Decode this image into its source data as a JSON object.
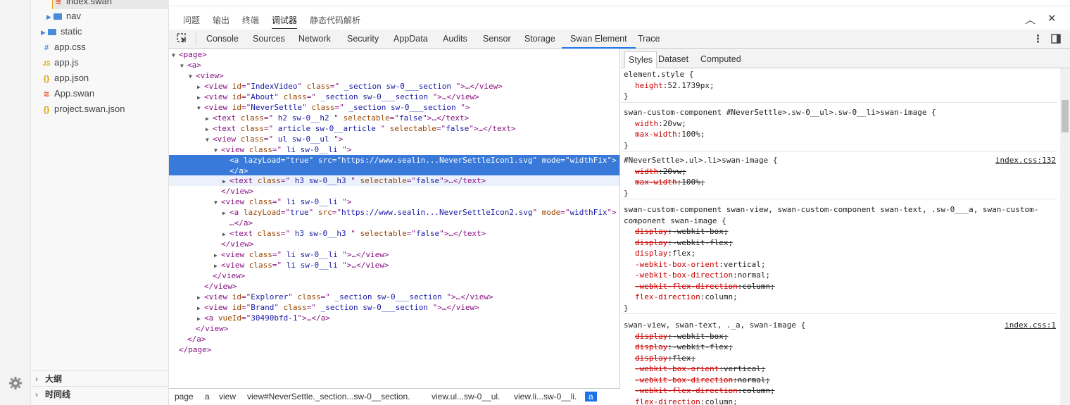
{
  "explorer": {
    "items": [
      {
        "label": "index.swan",
        "icon": "swan-file-icon",
        "type": "file"
      },
      {
        "label": "nav",
        "type": "folder"
      },
      {
        "label": "static",
        "type": "folder"
      },
      {
        "label": "app.css",
        "icon_glyph": "#",
        "type": "file"
      },
      {
        "label": "app.js",
        "icon_glyph": "JS",
        "type": "file"
      },
      {
        "label": "app.json",
        "icon_glyph": "{}",
        "type": "file"
      },
      {
        "label": "App.swan",
        "icon_glyph": "≋",
        "type": "file"
      },
      {
        "label": "project.swan.json",
        "icon_glyph": "{}",
        "type": "file"
      }
    ],
    "outline_label": "大纲",
    "timeline_label": "时间线"
  },
  "panel": {
    "tabs": [
      "问题",
      "输出",
      "终端",
      "调试器",
      "静态代码解析"
    ],
    "active_tab": "调试器"
  },
  "devtools": {
    "tabs": [
      "Console",
      "Sources",
      "Network",
      "Security",
      "AppData",
      "Audits",
      "Sensor",
      "Storage",
      "Swan Element",
      "Trace"
    ],
    "active_tab": "Swan Element"
  },
  "elements": {
    "lines": [
      {
        "tri": "▼",
        "parts": [
          [
            "tag",
            "<page>"
          ]
        ]
      },
      {
        "tri": "▼",
        "parts": [
          [
            "tag",
            "<a>"
          ]
        ]
      },
      {
        "tri": "▼",
        "parts": [
          [
            "tag",
            "<view>"
          ]
        ]
      },
      {
        "tri": "▶",
        "parts": [
          [
            "tag",
            "<view "
          ],
          [
            "an",
            "id"
          ],
          [
            "tag",
            "=\""
          ],
          [
            "av",
            "IndexVideo"
          ],
          [
            "tag",
            "\" "
          ],
          [
            "an",
            "class"
          ],
          [
            "tag",
            "=\""
          ],
          [
            "av",
            " _section sw-0___section "
          ],
          [
            "tag",
            "\">…</view>"
          ]
        ]
      },
      {
        "tri": "▶",
        "parts": [
          [
            "tag",
            "<view "
          ],
          [
            "an",
            "id"
          ],
          [
            "tag",
            "=\""
          ],
          [
            "av",
            "About"
          ],
          [
            "tag",
            "\" "
          ],
          [
            "an",
            "class"
          ],
          [
            "tag",
            "=\""
          ],
          [
            "av",
            " _section sw-0___section "
          ],
          [
            "tag",
            "\">…</view>"
          ]
        ]
      },
      {
        "tri": "▼",
        "parts": [
          [
            "tag",
            "<view "
          ],
          [
            "an",
            "id"
          ],
          [
            "tag",
            "=\""
          ],
          [
            "av",
            "NeverSettle"
          ],
          [
            "tag",
            "\" "
          ],
          [
            "an",
            "class"
          ],
          [
            "tag",
            "=\""
          ],
          [
            "av",
            " _section sw-0___section "
          ],
          [
            "tag",
            "\">"
          ]
        ]
      },
      {
        "tri": "▶",
        "parts": [
          [
            "tag",
            "<text "
          ],
          [
            "an",
            "class"
          ],
          [
            "tag",
            "=\""
          ],
          [
            "av",
            " h2 sw-0__h2 "
          ],
          [
            "tag",
            "\" "
          ],
          [
            "an",
            "selectable"
          ],
          [
            "tag",
            "=\""
          ],
          [
            "av",
            "false"
          ],
          [
            "tag",
            "\">…</text>"
          ]
        ]
      },
      {
        "tri": "▶",
        "parts": [
          [
            "tag",
            "<text "
          ],
          [
            "an",
            "class"
          ],
          [
            "tag",
            "=\""
          ],
          [
            "av",
            " article sw-0__article "
          ],
          [
            "tag",
            "\" "
          ],
          [
            "an",
            "selectable"
          ],
          [
            "tag",
            "=\""
          ],
          [
            "av",
            "false"
          ],
          [
            "tag",
            "\">…</text>"
          ]
        ]
      },
      {
        "tri": "▼",
        "parts": [
          [
            "tag",
            "<view "
          ],
          [
            "an",
            "class"
          ],
          [
            "tag",
            "=\""
          ],
          [
            "av",
            " ul sw-0__ul "
          ],
          [
            "tag",
            "\">"
          ]
        ]
      },
      {
        "tri": "▼",
        "parts": [
          [
            "tag",
            "<view "
          ],
          [
            "an",
            "class"
          ],
          [
            "tag",
            "=\""
          ],
          [
            "av",
            " li sw-0__li "
          ],
          [
            "tag",
            "\">"
          ]
        ]
      },
      {
        "tri": "",
        "parts": [
          [
            "tag",
            "<a "
          ],
          [
            "an",
            "lazyLoad"
          ],
          [
            "tag",
            "=\""
          ],
          [
            "av",
            "true"
          ],
          [
            "tag",
            "\" "
          ],
          [
            "an",
            "src"
          ],
          [
            "tag",
            "=\""
          ],
          [
            "av",
            "https://www.sealin...NeverSettleIcon1.svg"
          ],
          [
            "tag",
            "\" "
          ],
          [
            "an",
            "mode"
          ],
          [
            "tag",
            "=\""
          ],
          [
            "av",
            "widthFix"
          ],
          [
            "tag",
            "\">"
          ]
        ]
      },
      {
        "tri": "",
        "parts": [
          [
            "tag",
            "</a>"
          ]
        ]
      },
      {
        "tri": "▶",
        "parts": [
          [
            "tag",
            "<text "
          ],
          [
            "an",
            "class"
          ],
          [
            "tag",
            "=\""
          ],
          [
            "av",
            " h3 sw-0__h3 "
          ],
          [
            "tag",
            "\" "
          ],
          [
            "an",
            "selectable"
          ],
          [
            "tag",
            "=\""
          ],
          [
            "av",
            "false"
          ],
          [
            "tag",
            "\">…</text>"
          ]
        ]
      },
      {
        "tri": "",
        "parts": [
          [
            "tag",
            "</view>"
          ]
        ]
      },
      {
        "tri": "▼",
        "parts": [
          [
            "tag",
            "<view "
          ],
          [
            "an",
            "class"
          ],
          [
            "tag",
            "=\""
          ],
          [
            "av",
            " li sw-0__li "
          ],
          [
            "tag",
            "\">"
          ]
        ]
      },
      {
        "tri": "▶",
        "parts": [
          [
            "tag",
            "<a "
          ],
          [
            "an",
            "lazyLoad"
          ],
          [
            "tag",
            "=\""
          ],
          [
            "av",
            "true"
          ],
          [
            "tag",
            "\" "
          ],
          [
            "an",
            "src"
          ],
          [
            "tag",
            "=\""
          ],
          [
            "av",
            "https://www.sealin...NeverSettleIcon2.svg"
          ],
          [
            "tag",
            "\" "
          ],
          [
            "an",
            "mode"
          ],
          [
            "tag",
            "=\""
          ],
          [
            "av",
            "widthFix"
          ],
          [
            "tag",
            "\">"
          ]
        ]
      },
      {
        "tri": "",
        "parts": [
          [
            "tag",
            "…</a>"
          ]
        ]
      },
      {
        "tri": "▶",
        "parts": [
          [
            "tag",
            "<text "
          ],
          [
            "an",
            "class"
          ],
          [
            "tag",
            "=\""
          ],
          [
            "av",
            " h3 sw-0__h3 "
          ],
          [
            "tag",
            "\" "
          ],
          [
            "an",
            "selectable"
          ],
          [
            "tag",
            "=\""
          ],
          [
            "av",
            "false"
          ],
          [
            "tag",
            "\">…</text>"
          ]
        ]
      },
      {
        "tri": "",
        "parts": [
          [
            "tag",
            "</view>"
          ]
        ]
      },
      {
        "tri": "▶",
        "parts": [
          [
            "tag",
            "<view "
          ],
          [
            "an",
            "class"
          ],
          [
            "tag",
            "=\""
          ],
          [
            "av",
            " li sw-0__li "
          ],
          [
            "tag",
            "\">…</view>"
          ]
        ]
      },
      {
        "tri": "▶",
        "parts": [
          [
            "tag",
            "<view "
          ],
          [
            "an",
            "class"
          ],
          [
            "tag",
            "=\""
          ],
          [
            "av",
            " li sw-0__li "
          ],
          [
            "tag",
            "\">…</view>"
          ]
        ]
      },
      {
        "tri": "",
        "parts": [
          [
            "tag",
            "</view>"
          ]
        ]
      },
      {
        "tri": "",
        "parts": [
          [
            "tag",
            "</view>"
          ]
        ]
      },
      {
        "tri": "▶",
        "parts": [
          [
            "tag",
            "<view "
          ],
          [
            "an",
            "id"
          ],
          [
            "tag",
            "=\""
          ],
          [
            "av",
            "Explorer"
          ],
          [
            "tag",
            "\" "
          ],
          [
            "an",
            "class"
          ],
          [
            "tag",
            "=\""
          ],
          [
            "av",
            " _section sw-0___section "
          ],
          [
            "tag",
            "\">…</view>"
          ]
        ]
      },
      {
        "tri": "▶",
        "parts": [
          [
            "tag",
            "<view "
          ],
          [
            "an",
            "id"
          ],
          [
            "tag",
            "=\""
          ],
          [
            "av",
            "Brand"
          ],
          [
            "tag",
            "\" "
          ],
          [
            "an",
            "class"
          ],
          [
            "tag",
            "=\""
          ],
          [
            "av",
            " _section sw-0___section "
          ],
          [
            "tag",
            "\">…</view>"
          ]
        ]
      },
      {
        "tri": "▶",
        "parts": [
          [
            "tag",
            "<a "
          ],
          [
            "an",
            "vueId"
          ],
          [
            "tag",
            "=\""
          ],
          [
            "av",
            "30490bfd-1"
          ],
          [
            "tag",
            "\">…</a>"
          ]
        ]
      },
      {
        "tri": "",
        "parts": [
          [
            "tag",
            "</view>"
          ]
        ]
      },
      {
        "tri": "",
        "parts": [
          [
            "tag",
            "</a>"
          ]
        ]
      },
      {
        "tri": "",
        "parts": [
          [
            "tag",
            "</page>"
          ]
        ]
      }
    ]
  },
  "breadcrumb": {
    "items": [
      "page",
      "a",
      "view",
      "view#NeverSettle._section...sw-0__section.",
      "view.ul...sw-0__ul.",
      "view.li...sw-0__li.",
      "a"
    ]
  },
  "styles": {
    "tabs": [
      "Styles",
      "Dataset",
      "Computed"
    ],
    "active_tab": "Styles",
    "rules": [
      {
        "selector": "element.style {",
        "source": "",
        "props": [
          {
            "name": "height",
            "value": "52.1739px;",
            "strike": false
          }
        ]
      },
      {
        "selector": "swan-custom-component #NeverSettle>.sw-0__ul>.sw-0__li>swan-image {",
        "source": "",
        "props": [
          {
            "name": "width",
            "value": "20vw;",
            "strike": false
          },
          {
            "name": "max-width",
            "value": "100%;",
            "strike": false
          }
        ]
      },
      {
        "selector": "#NeverSettle>.ul>.li>swan-image {",
        "source": "index.css:132",
        "props": [
          {
            "name": "width",
            "value": "20vw;",
            "strike": true
          },
          {
            "name": "max-width",
            "value": "100%;",
            "strike": true
          }
        ]
      },
      {
        "selector": "swan-custom-component swan-view, swan-custom-component swan-text, .sw-0___a, swan-custom-\ncomponent swan-image {",
        "source": "",
        "props": [
          {
            "name": "display",
            "value": "-webkit-box;",
            "strike": true
          },
          {
            "name": "display",
            "value": "-webkit-flex;",
            "strike": true
          },
          {
            "name": "display",
            "value": "flex;",
            "strike": false
          },
          {
            "name": "-webkit-box-orient",
            "value": "vertical;",
            "strike": false
          },
          {
            "name": "-webkit-box-direction",
            "value": "normal;",
            "strike": false
          },
          {
            "name": "-webkit-flex-direction",
            "value": "column;",
            "strike": true
          },
          {
            "name": "flex-direction",
            "value": "column;",
            "strike": false
          }
        ]
      },
      {
        "selector": "swan-view, swan-text, ._a, swan-image {",
        "source": "index.css:1",
        "props": [
          {
            "name": "display",
            "value": "-webkit-box;",
            "strike": true
          },
          {
            "name": "display",
            "value": "-webkit-flex;",
            "strike": true
          },
          {
            "name": "display",
            "value": "flex;",
            "strike": true
          },
          {
            "name": "-webkit-box-orient",
            "value": "vertical;",
            "strike": true
          },
          {
            "name": "-webkit-box-direction",
            "value": "normal;",
            "strike": true
          },
          {
            "name": "-webkit-flex-direction",
            "value": "column;",
            "strike": true
          },
          {
            "name": "flex-direction",
            "value": "column;",
            "strike": false
          }
        ]
      }
    ]
  },
  "colors": {
    "selection": "#3879d9",
    "accent": "#1a73e8",
    "tag": "#881280",
    "attr_name": "#994500",
    "attr_value": "#1a1aa6",
    "css_prop": "#c80000"
  }
}
